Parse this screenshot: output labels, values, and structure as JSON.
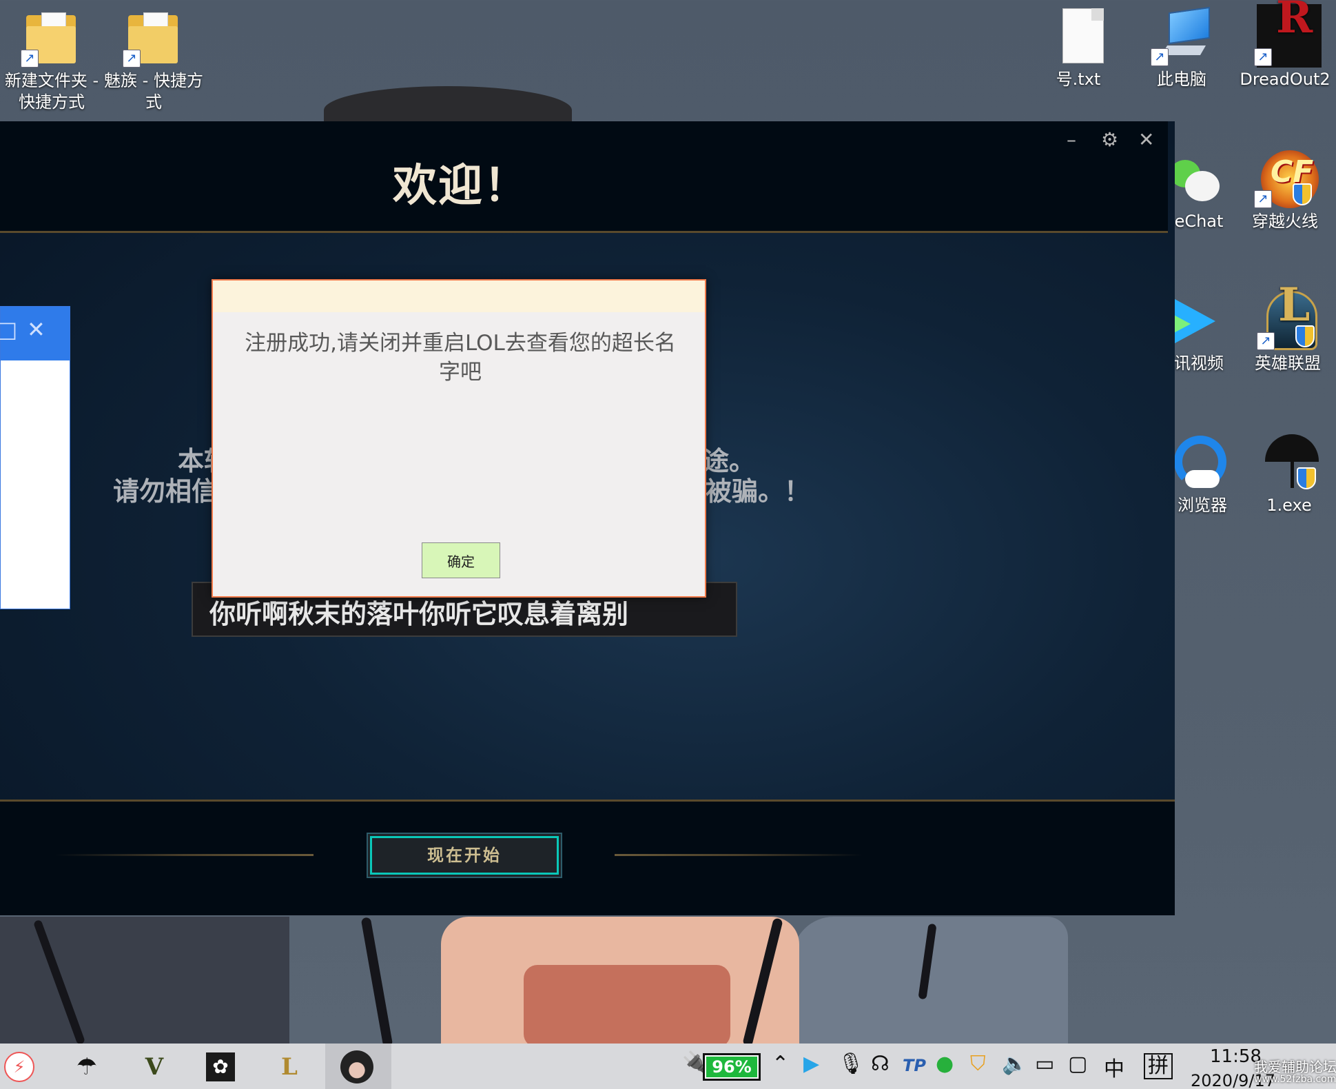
{
  "desktop": {
    "icons": [
      {
        "label": "新建文件夹 - 快捷方式"
      },
      {
        "label": "魅族 - 快捷方式"
      },
      {
        "label": "号.txt"
      },
      {
        "label": "此电脑"
      },
      {
        "label": "DreadOut2"
      },
      {
        "label": "eChat"
      },
      {
        "label": "穿越火线"
      },
      {
        "label": "讯视频"
      },
      {
        "label": "英雄联盟"
      },
      {
        "label": "浏览器"
      },
      {
        "label": "1.exe"
      }
    ]
  },
  "lol_window": {
    "title": "欢迎！",
    "controls": {
      "minimize": "–",
      "settings": "⚙",
      "close": "✕"
    },
    "notice_line1": "本软",
    "notice_line1_end": "途。",
    "notice_line2": "请勿相信",
    "notice_line2_end": "被骗。！",
    "name_input_value": "你听啊秋末的落叶你听它叹息着离别",
    "start_button": "现在开始"
  },
  "side_window": {
    "restore": "□",
    "close": "✕"
  },
  "modal": {
    "message": "注册成功,请关闭并重启LOL去查看您的超长名字吧",
    "ok_button": "确定"
  },
  "taskbar": {
    "battery_percent": "96%",
    "ime_lang": "中",
    "ime_mode": "拼",
    "time": "11:58",
    "date": "2020/9/17",
    "watermark": "我爱辅助论坛",
    "watermark_url": "www.52fzba.com"
  }
}
